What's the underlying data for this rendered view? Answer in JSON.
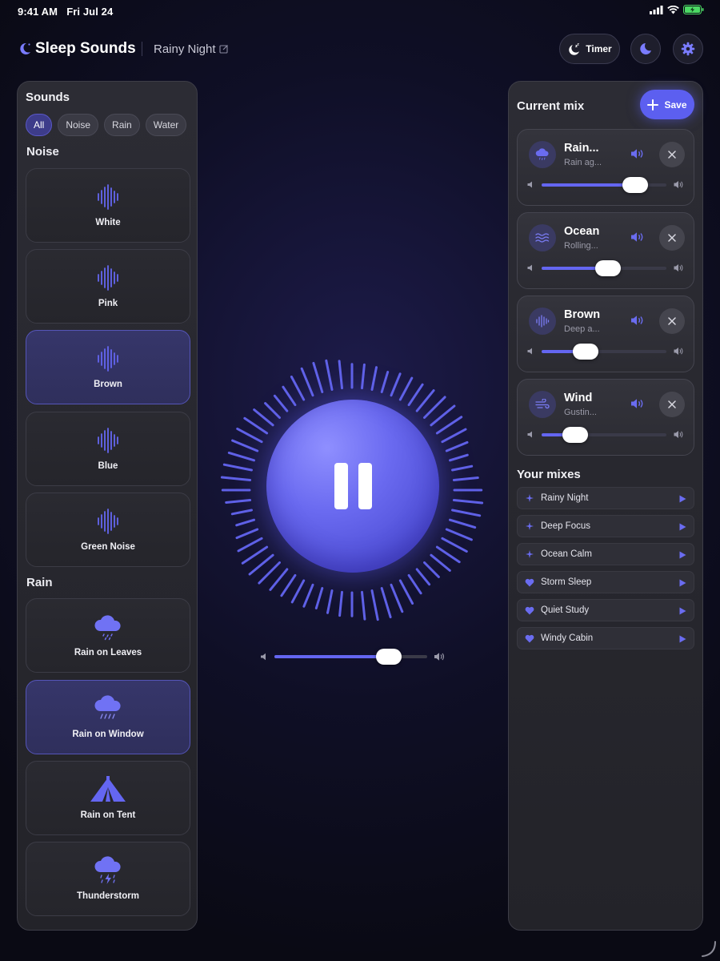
{
  "status_bar": {
    "time": "9:41 AM",
    "date": "Fri Jul 24",
    "icons": [
      "cellular-icon",
      "wifi-icon",
      "battery-charging-icon"
    ]
  },
  "header": {
    "app_title": "Sleep Sounds",
    "mix_title": "Rainy Night",
    "timer_label": "Timer",
    "icons": [
      "moon-logo-icon",
      "edit-icon",
      "timer-moon-icon",
      "moon-icon",
      "gear-icon"
    ]
  },
  "sounds_panel": {
    "title": "Sounds",
    "filters": [
      {
        "label": "All",
        "active": true
      },
      {
        "label": "Noise",
        "active": false
      },
      {
        "label": "Rain",
        "active": false
      },
      {
        "label": "Water",
        "active": false
      }
    ],
    "sections": [
      {
        "label": "Noise",
        "items": [
          {
            "label": "White",
            "icon": "waveform-icon",
            "selected": false
          },
          {
            "label": "Pink",
            "icon": "waveform-icon",
            "selected": false
          },
          {
            "label": "Brown",
            "icon": "waveform-icon",
            "selected": true
          },
          {
            "label": "Blue",
            "icon": "waveform-icon",
            "selected": false
          },
          {
            "label": "Green Noise",
            "icon": "waveform-icon",
            "selected": false
          }
        ]
      },
      {
        "label": "Rain",
        "items": [
          {
            "label": "Rain on Leaves",
            "icon": "cloud-rain-icon",
            "selected": false
          },
          {
            "label": "Rain on Window",
            "icon": "cloud-heavy-rain-icon",
            "selected": true
          },
          {
            "label": "Rain on Tent",
            "icon": "tent-icon",
            "selected": false
          },
          {
            "label": "Thunderstorm",
            "icon": "cloud-bolt-icon",
            "selected": false
          }
        ]
      }
    ]
  },
  "player": {
    "state": "playing",
    "master_volume": 0.75,
    "accent": "#6466f1"
  },
  "current_mix": {
    "title": "Current mix",
    "save_label": "Save",
    "items": [
      {
        "name": "Rain...",
        "subtitle": "Rain ag...",
        "icon": "cloud-rain-icon",
        "volume": 0.75
      },
      {
        "name": "Ocean",
        "subtitle": "Rolling...",
        "icon": "waves-icon",
        "volume": 0.53
      },
      {
        "name": "Brown",
        "subtitle": "Deep a...",
        "icon": "waveform-icon",
        "volume": 0.35
      },
      {
        "name": "Wind",
        "subtitle": "Gustin...",
        "icon": "wind-icon",
        "volume": 0.27
      }
    ]
  },
  "your_mixes": {
    "title": "Your mixes",
    "items": [
      {
        "label": "Rainy Night",
        "icon": "sparkle-icon"
      },
      {
        "label": "Deep Focus",
        "icon": "sparkle-icon"
      },
      {
        "label": "Ocean Calm",
        "icon": "sparkle-icon"
      },
      {
        "label": "Storm Sleep",
        "icon": "heart-icon"
      },
      {
        "label": "Quiet Study",
        "icon": "heart-icon"
      },
      {
        "label": "Windy Cabin",
        "icon": "heart-icon"
      }
    ]
  }
}
